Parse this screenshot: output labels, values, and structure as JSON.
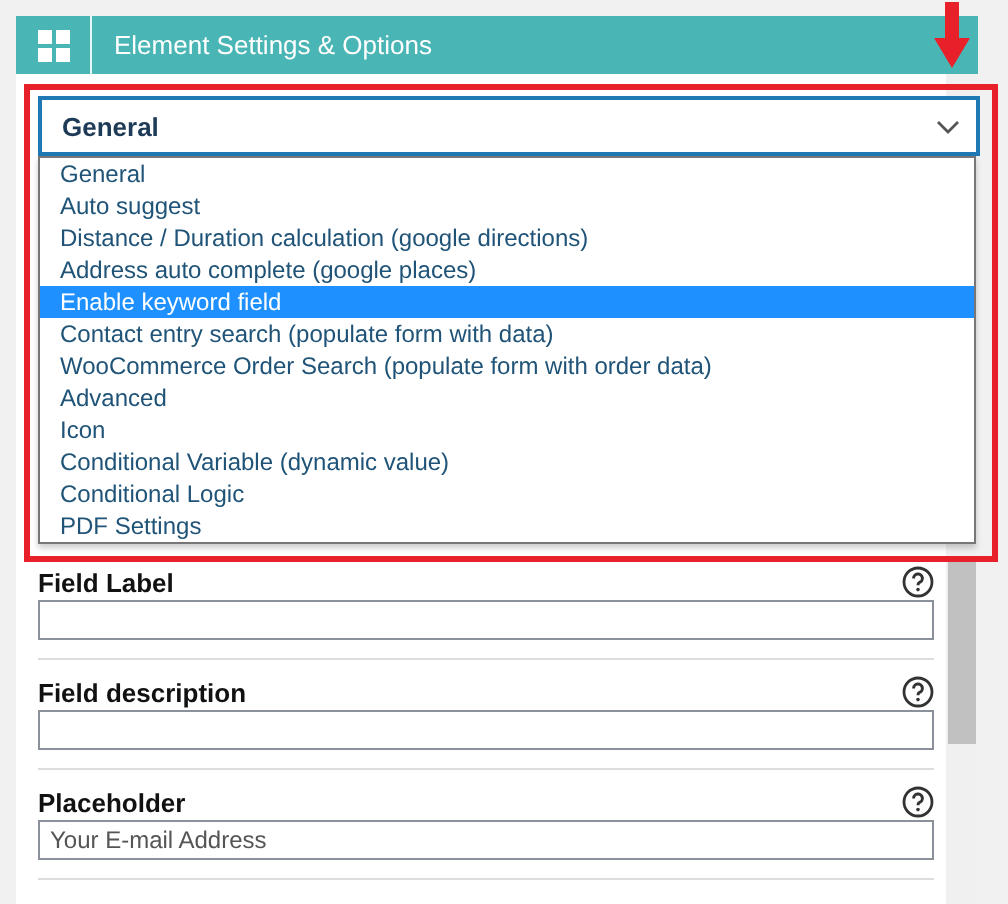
{
  "header": {
    "title": "Element Settings & Options"
  },
  "section_select": {
    "value": "General",
    "options": [
      {
        "label": "General",
        "highlighted": false
      },
      {
        "label": "Auto suggest",
        "highlighted": false
      },
      {
        "label": "Distance / Duration calculation (google directions)",
        "highlighted": false
      },
      {
        "label": "Address auto complete (google places)",
        "highlighted": false
      },
      {
        "label": "Enable keyword field",
        "highlighted": true
      },
      {
        "label": "Contact entry search (populate form with data)",
        "highlighted": false
      },
      {
        "label": "WooCommerce Order Search (populate form with order data)",
        "highlighted": false
      },
      {
        "label": "Advanced",
        "highlighted": false
      },
      {
        "label": "Icon",
        "highlighted": false
      },
      {
        "label": "Conditional Variable (dynamic value)",
        "highlighted": false
      },
      {
        "label": "Conditional Logic",
        "highlighted": false
      },
      {
        "label": "PDF Settings",
        "highlighted": false
      }
    ]
  },
  "fields": [
    {
      "label": "Field Label"
    },
    {
      "label": "Field description"
    },
    {
      "label": "Placeholder",
      "value": "Your E-mail Address"
    }
  ]
}
